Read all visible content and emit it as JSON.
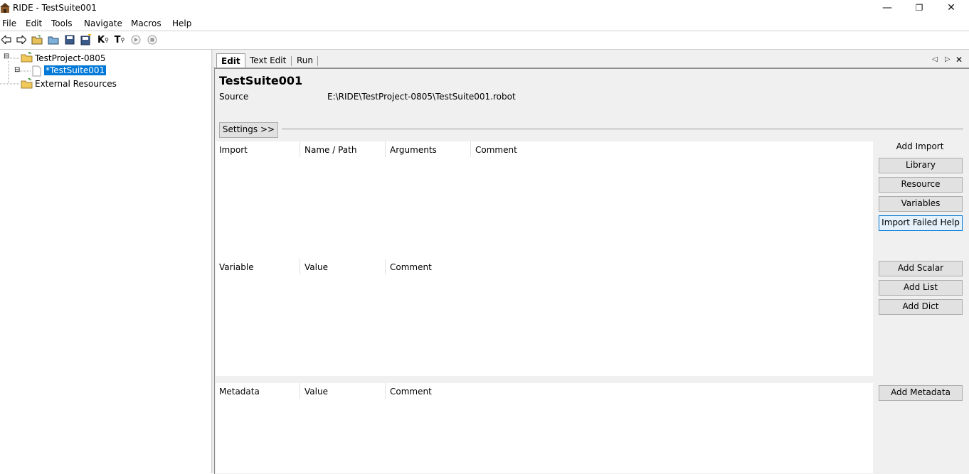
{
  "window": {
    "title": "RIDE - TestSuite001",
    "minimize": "—",
    "restore": "❐",
    "close": "✕"
  },
  "menu": [
    "File",
    "Edit",
    "Tools",
    "Navigate",
    "Macros",
    "Help"
  ],
  "tree": {
    "project": "TestProject-0805",
    "suite": "*TestSuite001",
    "external": "External Resources",
    "collapse_glyph": "⊟"
  },
  "tabs": {
    "edit": "Edit",
    "text_edit": "Text Edit",
    "run": "Run"
  },
  "tab_nav": {
    "left": "◁",
    "right": "▷",
    "close": "✕"
  },
  "suite": {
    "title": "TestSuite001",
    "source_label": "Source",
    "source_path": "E:\\RIDE\\TestProject-0805\\TestSuite001.robot"
  },
  "settings_button": "Settings >>",
  "import_table": {
    "headers": [
      "Import",
      "Name / Path",
      "Arguments",
      "Comment"
    ]
  },
  "variable_table": {
    "headers": [
      "Variable",
      "Value",
      "Comment"
    ]
  },
  "metadata_table": {
    "headers": [
      "Metadata",
      "Value",
      "Comment"
    ]
  },
  "side_buttons": {
    "add_import_label": "Add Import",
    "library": "Library",
    "resource": "Resource",
    "variables": "Variables",
    "import_failed_help": "Import Failed Help",
    "add_scalar": "Add Scalar",
    "add_list": "Add List",
    "add_dict": "Add Dict",
    "add_metadata": "Add Metadata"
  },
  "colors": {
    "selection": "#0078d7",
    "panel_bg": "#f0f0f0",
    "button_bg": "#e1e1e1"
  }
}
